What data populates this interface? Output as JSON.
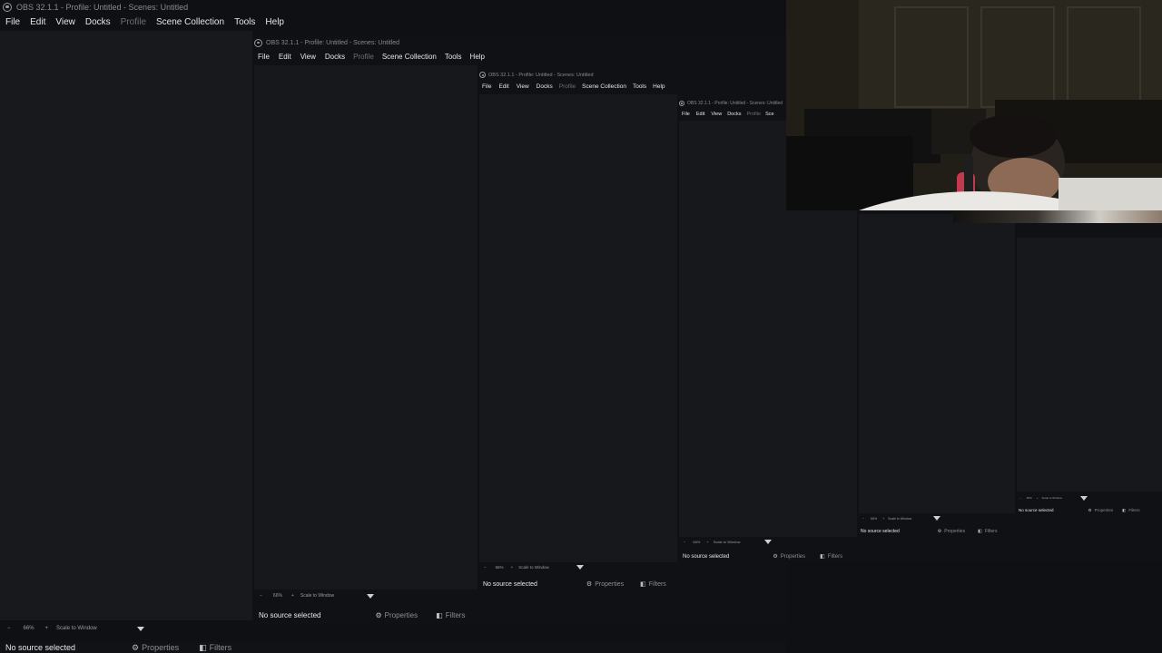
{
  "window": {
    "title": "OBS 32.1.1 - Profile: Untitled - Scenes: Untitled"
  },
  "menu": {
    "file": "File",
    "edit": "Edit",
    "view": "View",
    "docks": "Docks",
    "profile": "Profile",
    "scene_collection": "Scene Collection",
    "tools": "Tools",
    "help": "Help",
    "scene_short": "Sce"
  },
  "preview_controls": {
    "minus": "−",
    "zoom": "66%",
    "plus": "+",
    "scale_mode": "Scale to Window"
  },
  "context_bar": {
    "no_source": "No source selected",
    "properties": "Properties",
    "filters": "Filters"
  },
  "icons": {
    "properties": "gear-icon",
    "filters": "filter-icon",
    "app": "obs-logo-icon"
  }
}
